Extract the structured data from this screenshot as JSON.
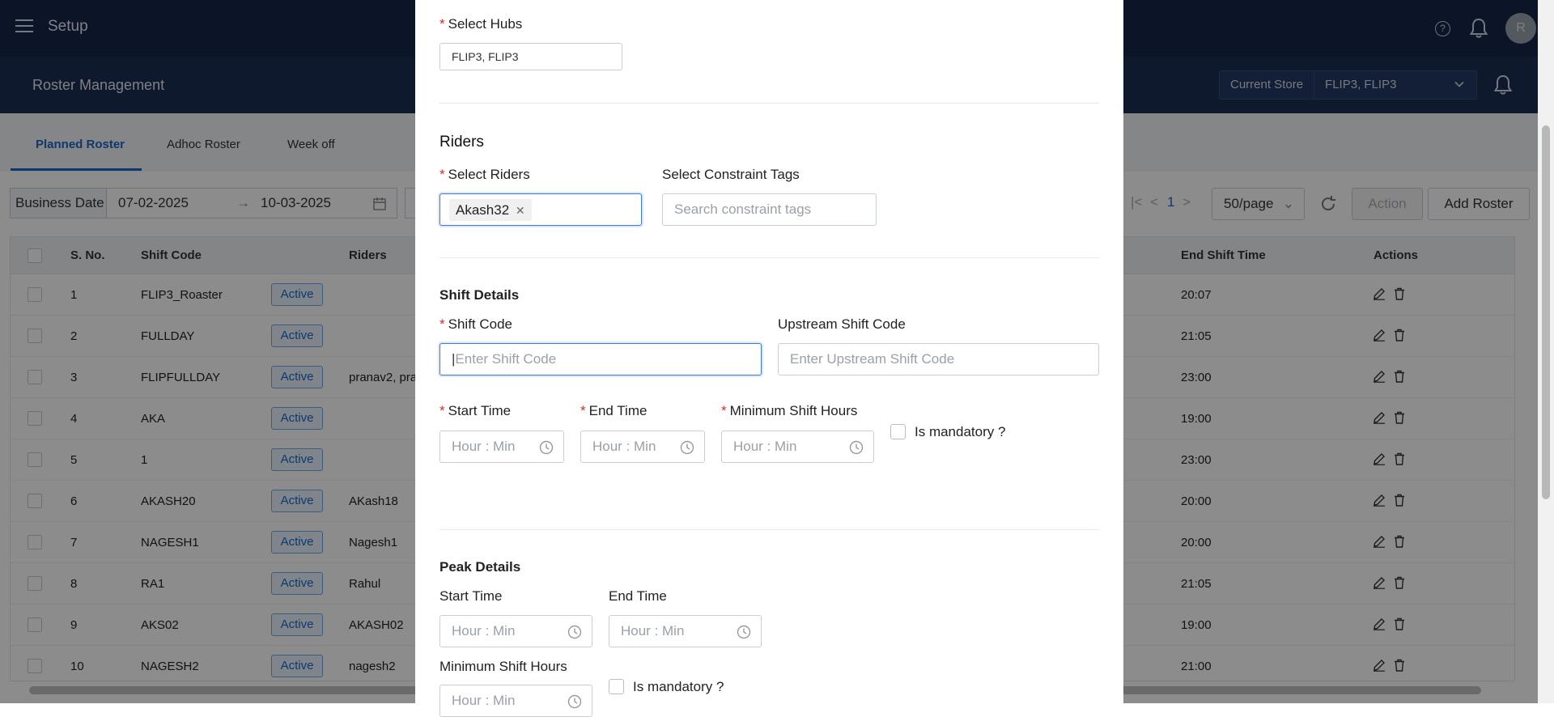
{
  "app": {
    "title": "Setup",
    "avatar_initial": "R"
  },
  "page": {
    "title": "Roster Management"
  },
  "store": {
    "label": "Current Store",
    "value": "FLIP3, FLIP3"
  },
  "tabs": [
    "Planned Roster",
    "Adhoc Roster",
    "Week off"
  ],
  "filters": {
    "date_label": "Business Date",
    "from_date": "07-02-2025",
    "to_date": "10-03-2025"
  },
  "pagination": {
    "page": "1",
    "page_size": "50/page"
  },
  "toolbar": {
    "action_label": "Action",
    "add_label": "Add Roster"
  },
  "table": {
    "headers": {
      "sno": "S. No.",
      "shift_code": "Shift Code",
      "riders": "Riders",
      "end_shift_time": "End Shift Time",
      "actions": "Actions"
    },
    "rows": [
      {
        "sno": "1",
        "shift_code": "FLIP3_Roaster",
        "status": "Active",
        "riders": "",
        "end": "20:07"
      },
      {
        "sno": "2",
        "shift_code": "FULLDAY",
        "status": "Active",
        "riders": "",
        "end": "21:05"
      },
      {
        "sno": "3",
        "shift_code": "FLIPFULLDAY",
        "status": "Active",
        "riders": "pranav2, pra",
        "end": "23:00"
      },
      {
        "sno": "4",
        "shift_code": "AKA",
        "status": "Active",
        "riders": "",
        "end": "19:00"
      },
      {
        "sno": "5",
        "shift_code": "1",
        "status": "Active",
        "riders": "",
        "end": "23:00"
      },
      {
        "sno": "6",
        "shift_code": "AKASH20",
        "status": "Active",
        "riders": "AKash18",
        "end": "20:00"
      },
      {
        "sno": "7",
        "shift_code": "NAGESH1",
        "status": "Active",
        "riders": "Nagesh1",
        "end": "20:00"
      },
      {
        "sno": "8",
        "shift_code": "RA1",
        "status": "Active",
        "riders": "Rahul",
        "end": "21:05"
      },
      {
        "sno": "9",
        "shift_code": "AKS02",
        "status": "Active",
        "riders": "AKASH02",
        "end": "19:00"
      },
      {
        "sno": "10",
        "shift_code": "NAGESH2",
        "status": "Active",
        "riders": "nagesh2",
        "end": "21:00"
      }
    ]
  },
  "modal": {
    "hubs": {
      "label": "Select Hubs",
      "value": "FLIP3, FLIP3"
    },
    "riders_section": "Riders",
    "select_riders": {
      "label": "Select Riders",
      "tag": "Akash32"
    },
    "constraint_tags": {
      "label": "Select Constraint Tags",
      "placeholder": "Search constraint tags"
    },
    "shift_section": "Shift Details",
    "shift_code": {
      "label": "Shift Code",
      "placeholder": "Enter Shift Code"
    },
    "upstream_code": {
      "label": "Upstream Shift Code",
      "placeholder": "Enter Upstream Shift Code"
    },
    "start_time": {
      "label": "Start Time",
      "placeholder": "Hour : Min"
    },
    "end_time": {
      "label": "End Time",
      "placeholder": "Hour : Min"
    },
    "min_hours": {
      "label": "Minimum Shift Hours",
      "placeholder": "Hour : Min"
    },
    "mandatory": "Is mandatory ?",
    "peak_section": "Peak Details",
    "peak_start": {
      "label": "Start Time",
      "placeholder": "Hour : Min"
    },
    "peak_end": {
      "label": "End Time",
      "placeholder": "Hour : Min"
    },
    "peak_min_hours": {
      "label": "Minimum Shift Hours",
      "placeholder": "Hour : Min"
    },
    "peak_mandatory": "Is mandatory ?"
  },
  "colors": {
    "header_bg": "#152747",
    "accent": "#1a66c9",
    "required": "#e0282e"
  }
}
